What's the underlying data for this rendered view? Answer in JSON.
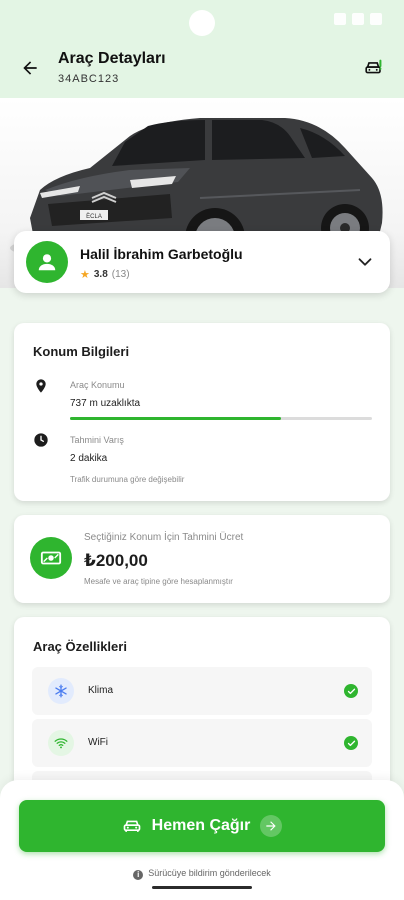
{
  "header": {
    "title": "Araç Detayları",
    "plate": "34ABC123"
  },
  "driver": {
    "name": "Halil İbrahim Garbetoğlu",
    "rating": "3.8",
    "rating_count": "(13)"
  },
  "car": {
    "plate_badge": "ËCLA"
  },
  "location_card": {
    "title": "Konum Bilgileri",
    "vehicle_location_label": "Araç Konumu",
    "vehicle_location_value": "737 m uzaklıkta",
    "distance_progress": 0.7,
    "eta_label": "Tahmini Varış",
    "eta_value": "2 dakika",
    "traffic_note": "Trafik durumuna göre değişebilir"
  },
  "price_card": {
    "label": "Seçtiğiniz Konum İçin Tahmini Ücret",
    "value": "₺200,00",
    "note": "Mesafe ve araç tipine göre hesaplanmıştır"
  },
  "features_card": {
    "title": "Araç Özellikleri",
    "items": [
      {
        "name": "Klima",
        "icon": "snowflake-icon",
        "color": "#4a7cf0"
      },
      {
        "name": "WiFi",
        "icon": "wifi-icon",
        "color": "#2fb52f"
      }
    ]
  },
  "call_button": {
    "label": "Hemen Çağır"
  },
  "notify_text": "Sürücüye bildirim gönderilecek",
  "colors": {
    "accent": "#2fb52f",
    "header_bg": "#e3f5e4"
  }
}
